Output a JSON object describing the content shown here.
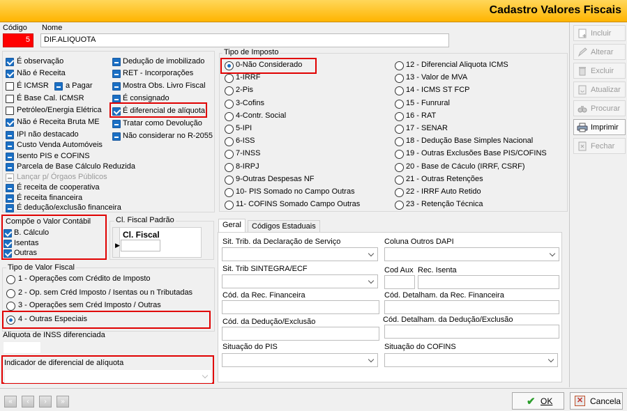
{
  "window": {
    "title": "Cadastro Valores Fiscais"
  },
  "header": {
    "codigo_label": "Código",
    "codigo_value": "5",
    "nome_label": "Nome",
    "nome_value": "DIF.ALIQUOTA"
  },
  "flags_col1": [
    {
      "label": "É observação",
      "state": "on"
    },
    {
      "label": "Não é Receita",
      "state": "on"
    },
    {
      "label": "É ICMSR",
      "state": "off"
    },
    {
      "label": "É Base Cal. ICMSR",
      "state": "off"
    },
    {
      "label": "Petróleo/Energia Elétrica",
      "state": "off"
    },
    {
      "label": "Não é Receita Bruta ME",
      "state": "on"
    },
    {
      "label": "IPI não destacado",
      "state": "ind"
    },
    {
      "label": "Custo Venda Automóveis",
      "state": "ind"
    },
    {
      "label": "Isento PIS e COFINS",
      "state": "ind"
    },
    {
      "label": "Parcela de Base Cálculo Reduzida",
      "state": "ind"
    },
    {
      "label": "Lançar p/ Órgaos Públicos",
      "state": "dis"
    },
    {
      "label": "É receita de cooperativa",
      "state": "ind"
    },
    {
      "label": "É receita financeira",
      "state": "ind"
    },
    {
      "label": "É dedução/exclusão financeira",
      "state": "ind"
    }
  ],
  "a_pagar": {
    "label": "a Pagar",
    "state": "ind"
  },
  "flags_col2": [
    {
      "label": "Dedução de imobilizado",
      "state": "ind"
    },
    {
      "label": "RET - Incorporações",
      "state": "ind"
    },
    {
      "label": "Mostra Obs. Livro Fiscal",
      "state": "ind"
    },
    {
      "label": "É consignado",
      "state": "ind"
    },
    {
      "label": "É diferencial de alíquota",
      "state": "on"
    },
    {
      "label": "Tratar como Devolução",
      "state": "ind"
    },
    {
      "label": "Não considerar no R-2055",
      "state": "ind"
    }
  ],
  "tipo_imposto": {
    "title": "Tipo de Imposto",
    "col1": [
      "0-Não Considerado",
      "1-IRRF",
      "2-Pis",
      "3-Cofins",
      "4-Contr. Social",
      "5-IPI",
      "6-ISS",
      "7-INSS",
      "8-IRPJ",
      "9-Outras Despesas NF",
      "10- PIS Somado no Campo Outras",
      "11- COFINS Somado Campo Outras"
    ],
    "col2": [
      "12 - Diferencial Aliquota ICMS",
      "13 - Valor de MVA",
      "14 - ICMS ST FCP",
      "15 - Funrural",
      "16 - RAT",
      "17 - SENAR",
      "18 - Dedução Base Simples Nacional",
      "19 - Outras Exclusões Base PIS/COFINS",
      "20 - Base de Cáculo (IRRF, CSRF)",
      "21 - Outras Retenções",
      "22 - IRRF Auto Retido",
      "23 - Retenção Técnica"
    ],
    "selected": "0-Não Considerado"
  },
  "compoe": {
    "title": "Compõe o Valor Contábil",
    "items": [
      "B. Cálculo",
      "Isentas",
      "Outras"
    ]
  },
  "cl_fiscal": {
    "title": "Cl. Fiscal Padrão",
    "header": "Cl. Fiscal"
  },
  "tipo_valor": {
    "title": "Tipo de Valor Fiscal",
    "options": [
      "1 - Operações com Crédito de Imposto",
      "2 - Op. sem Créd Imposto / Isentas ou n Tributadas",
      "3 - Operações sem Créd Imposto / Outras",
      "4 - Outras Especiais"
    ],
    "selected": "4 - Outras Especiais"
  },
  "aliquota_inss": {
    "label": "Aliquota de INSS diferenciada",
    "value": ""
  },
  "indicador": {
    "label": "Indicador de diferencial de alíquota",
    "value": ""
  },
  "tabs": [
    "Geral",
    "Códigos Estaduais"
  ],
  "geral": {
    "sit_trib_servico": "Sit. Trib. da Declaração de Serviço",
    "coluna_dapi": "Coluna Outros DAPI",
    "sit_trib_sintegra": "Sit. Trib SINTEGRA/ECF",
    "cod_aux": "Cod Aux",
    "rec_isenta": "Rec. Isenta",
    "cod_rec_fin": "Cód. da  Rec. Financeira",
    "cod_det_rec_fin": "Cód.  Detalham. da Rec. Financeira",
    "cod_deducao": "Cód. da  Dedução/Exclusão",
    "cod_det_deducao": "Cód.  Detalham. da Dedução/Exclusão",
    "sit_pis": "Situação do PIS",
    "sit_cofins": "Situação do COFINS"
  },
  "toolbar": [
    {
      "label": "Incluir",
      "icon": "add-doc-icon",
      "active": false
    },
    {
      "label": "Alterar",
      "icon": "edit-icon",
      "active": false
    },
    {
      "label": "Excluir",
      "icon": "delete-icon",
      "active": false
    },
    {
      "label": "Atualizar",
      "icon": "refresh-icon",
      "active": false
    },
    {
      "label": "Procurar",
      "icon": "binoculars-icon",
      "active": false
    },
    {
      "label": "Imprimir",
      "icon": "printer-icon",
      "active": true
    },
    {
      "label": "Fechar",
      "icon": "close-door-icon",
      "active": false
    }
  ],
  "footer": {
    "ok": "OK",
    "cancel": "Cancela"
  },
  "colors": {
    "accent": "#1a6fc4",
    "highlight": "#e00000",
    "title_bar": "#ffc21a"
  }
}
